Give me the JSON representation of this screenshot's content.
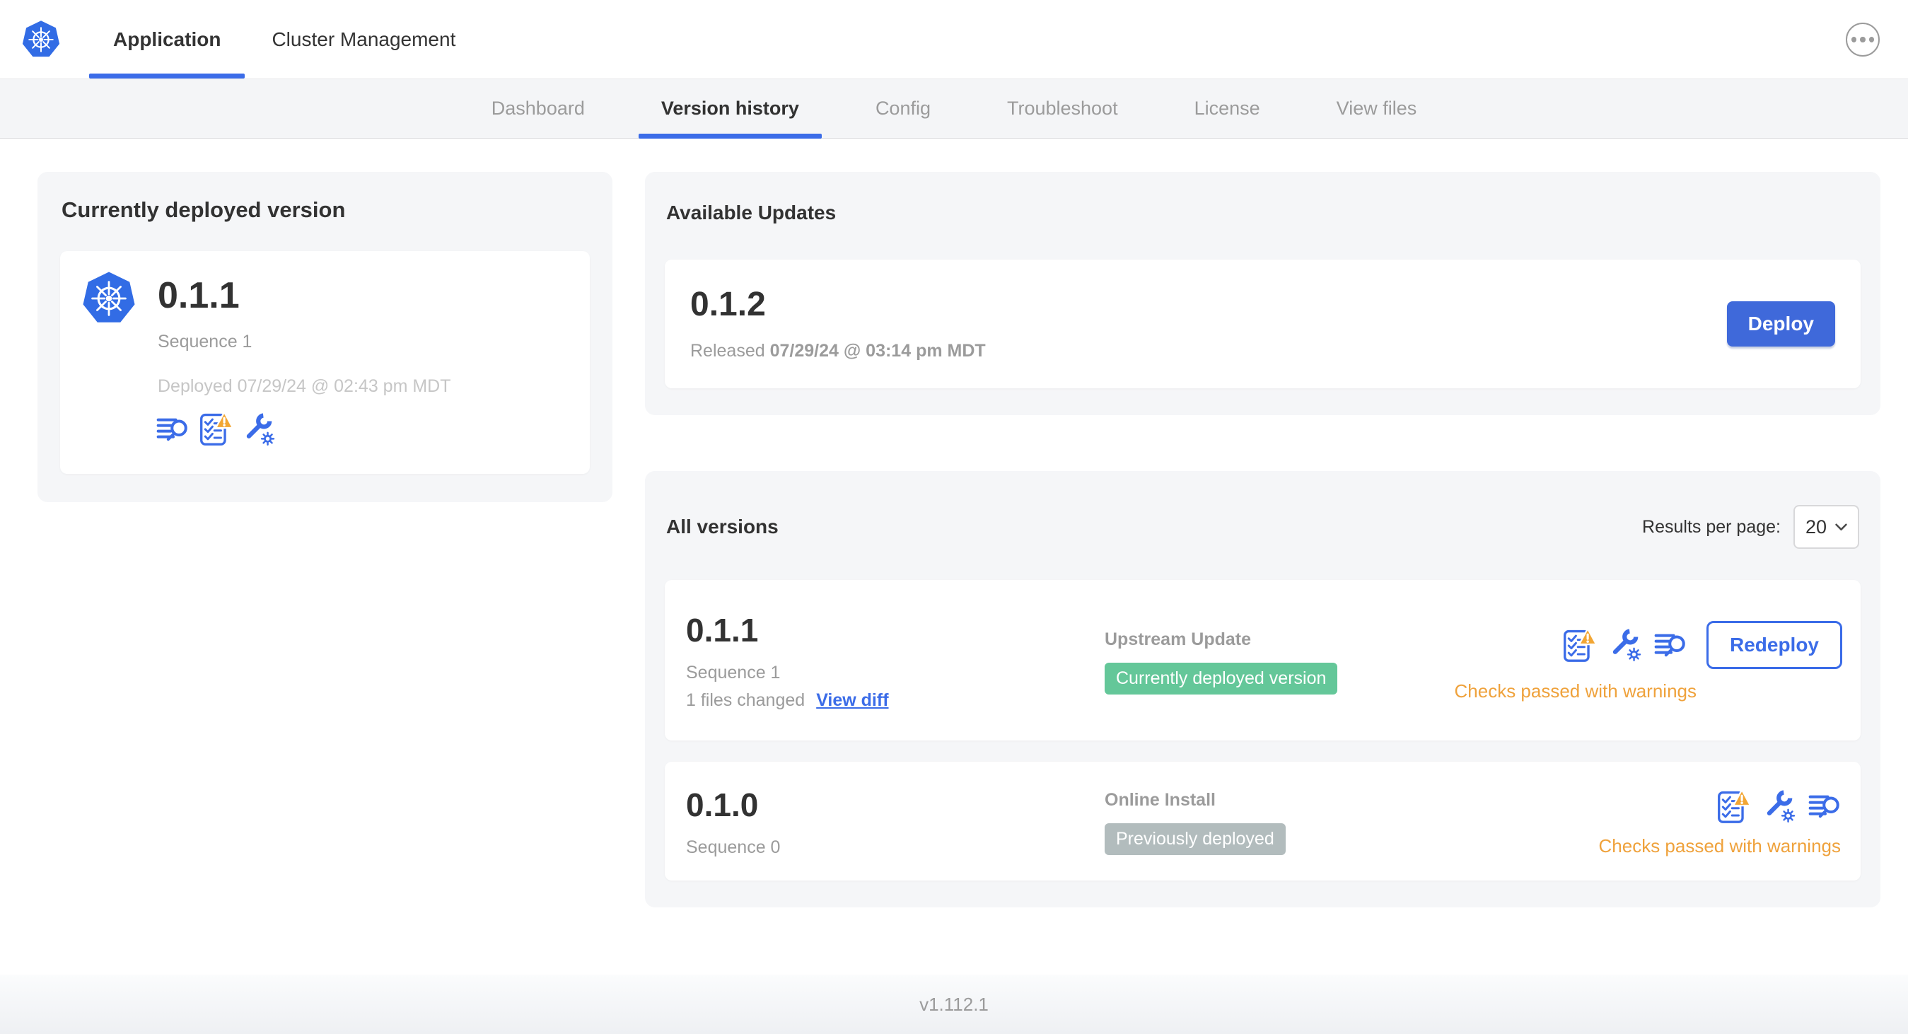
{
  "colors": {
    "accent_blue": "#3b6ce8",
    "logo_blue": "#326ce5",
    "deploy_button_blue": "#3f69da",
    "badge_green": "#64c799",
    "badge_gray": "#b2bcbd",
    "warning_orange": "#efa23c",
    "card_background": "#f5f6f8"
  },
  "header": {
    "tabs": [
      {
        "label": "Application",
        "active": true
      },
      {
        "label": "Cluster Management",
        "active": false
      }
    ],
    "more_icon": "ellipsis-icon",
    "logo_icon": "kubernetes-logo"
  },
  "nav": {
    "items": [
      {
        "label": "Dashboard",
        "active": false
      },
      {
        "label": "Version history",
        "active": true
      },
      {
        "label": "Config",
        "active": false
      },
      {
        "label": "Troubleshoot",
        "active": false
      },
      {
        "label": "License",
        "active": false
      },
      {
        "label": "View files",
        "active": false
      }
    ]
  },
  "currently_deployed": {
    "title": "Currently deployed version",
    "version": "0.1.1",
    "sequence": "Sequence 1",
    "deployed_at": "Deployed 07/29/24 @ 02:43 pm MDT",
    "icons": [
      "diff-lines-icon",
      "preflight-checklist-warning-icon",
      "config-wrench-icon"
    ]
  },
  "available_updates": {
    "title": "Available Updates",
    "version": "0.1.2",
    "released_label": "Released",
    "released_at": "07/29/24 @ 03:14 pm MDT",
    "deploy_button": "Deploy"
  },
  "all_versions": {
    "title": "All versions",
    "results_per_page_label": "Results per page:",
    "results_per_page": "20",
    "rows": [
      {
        "version": "0.1.1",
        "sequence": "Sequence 1",
        "files_changed": "1 files changed",
        "view_diff_link": "View diff",
        "source": "Upstream Update",
        "badge": "Currently deployed version",
        "badge_style": "green",
        "icons": [
          "preflight-checklist-warning-icon",
          "config-wrench-icon",
          "diff-lines-icon"
        ],
        "action_button": "Redeploy",
        "status": "Checks passed with warnings"
      },
      {
        "version": "0.1.0",
        "sequence": "Sequence 0",
        "source": "Online Install",
        "badge": "Previously deployed",
        "badge_style": "gray",
        "icons": [
          "preflight-checklist-warning-icon",
          "config-wrench-icon",
          "diff-lines-icon"
        ],
        "status": "Checks passed with warnings"
      }
    ]
  },
  "footer": {
    "version_label": "v1.112.1"
  }
}
